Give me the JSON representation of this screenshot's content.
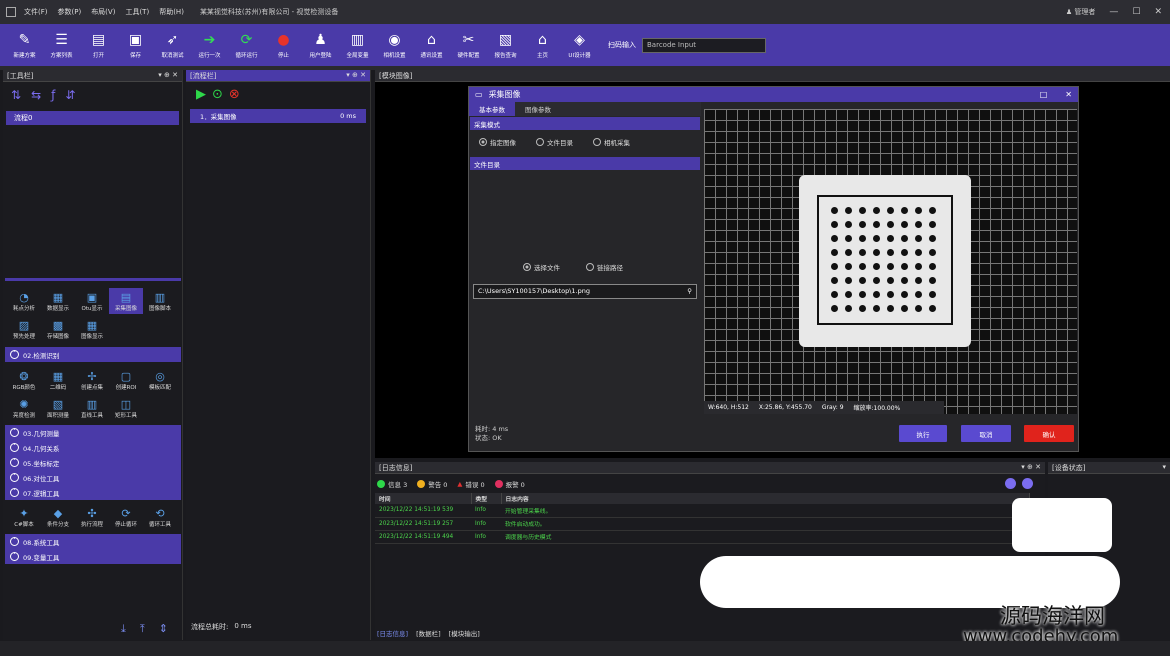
{
  "titlebar": {
    "menu": [
      "文件(F)",
      "参数(P)",
      "布局(V)",
      "工具(T)",
      "帮助(H)"
    ],
    "title": "某某视觉科技(苏州)有限公司 - 视觉检测设备",
    "user": "管理者",
    "min": "—",
    "max": "☐",
    "close": "✕"
  },
  "toolbar": {
    "buttons": [
      {
        "label": "新建方案",
        "icon": "✎",
        "color": "#ffffff"
      },
      {
        "label": "方案列表",
        "icon": "☰",
        "color": "#ffffff"
      },
      {
        "label": "打开",
        "icon": "▤",
        "color": "#ffffff"
      },
      {
        "label": "保存",
        "icon": "▣",
        "color": "#ffffff"
      },
      {
        "label": "取消测试",
        "icon": "➶",
        "color": "#ffffff"
      },
      {
        "label": "运行一次",
        "icon": "➔",
        "color": "#33dd55"
      },
      {
        "label": "循环运行",
        "icon": "⟳",
        "color": "#33dd55"
      },
      {
        "label": "停止",
        "icon": "●",
        "color": "#e8332a"
      },
      {
        "label": "用户登陆",
        "icon": "♟",
        "color": "#ffffff"
      },
      {
        "label": "全局变量",
        "icon": "▥",
        "color": "#ffffff"
      },
      {
        "label": "相机设置",
        "icon": "◉",
        "color": "#ffffff"
      },
      {
        "label": "通讯设置",
        "icon": "⌂",
        "color": "#ffffff"
      },
      {
        "label": "硬件配置",
        "icon": "✂",
        "color": "#ffffff"
      },
      {
        "label": "报告查询",
        "icon": "▧",
        "color": "#ffffff"
      },
      {
        "label": "主页",
        "icon": "⌂",
        "color": "#ffffff"
      },
      {
        "label": "UI设计器",
        "icon": "◈",
        "color": "#ffffff"
      }
    ],
    "scan_label": "扫码输入",
    "barcode_placeholder": "Barcode Input"
  },
  "toolpanel": {
    "title": "[工具栏]",
    "pin": "▾ ⊕ ✕",
    "flow_name": "流程0",
    "group1": [
      {
        "label": "耗点分析",
        "icon": "◔"
      },
      {
        "label": "数据显示",
        "icon": "▦"
      },
      {
        "label": "Otu显示",
        "icon": "▣"
      },
      {
        "label": "采集图像",
        "icon": "▤"
      },
      {
        "label": "图像脚本",
        "icon": "▥"
      },
      {
        "label": "预先处理",
        "icon": "▨"
      },
      {
        "label": "存储图像",
        "icon": "▩"
      },
      {
        "label": "图像显示",
        "icon": "▦"
      }
    ],
    "cat02": "02.检测识别",
    "group2": [
      {
        "label": "RGB颜色",
        "icon": "❂"
      },
      {
        "label": "二维码",
        "icon": "▦"
      },
      {
        "label": "创建点集",
        "icon": "✢"
      },
      {
        "label": "创建ROI",
        "icon": "▢"
      },
      {
        "label": "模板匹配",
        "icon": "◎"
      },
      {
        "label": "亮度检测",
        "icon": "✺"
      },
      {
        "label": "面积测量",
        "icon": "▧"
      },
      {
        "label": "直线工具",
        "icon": "▥"
      },
      {
        "label": "矩形工具",
        "icon": "◫"
      }
    ],
    "cats_a": [
      "03.几何测量",
      "04.几何关系",
      "05.坐标标定",
      "06.对位工具",
      "07.逻辑工具"
    ],
    "group3": [
      {
        "label": "C#脚本",
        "icon": "✦"
      },
      {
        "label": "条件分支",
        "icon": "◆"
      },
      {
        "label": "执行流程",
        "icon": "✣"
      },
      {
        "label": "停止循环",
        "icon": "⟳"
      },
      {
        "label": "循环工具",
        "icon": "⟲"
      }
    ],
    "cats_b": [
      "08.系统工具",
      "09.变量工具"
    ]
  },
  "flowpanel": {
    "title": "[流程栏]",
    "pin": "▾ ⊕ ✕",
    "item_name": "1．采集图像",
    "item_time": "0 ms",
    "total_label": "流程总耗时:",
    "total_value": "0 ms"
  },
  "imgpanel": {
    "title": "[模块图像]"
  },
  "dialog": {
    "title": "采集图像",
    "tabs": [
      "基本参数",
      "图像参数"
    ],
    "sec_mode": "采集模式",
    "modes": [
      "指定图像",
      "文件目录",
      "相机采集"
    ],
    "sec_dir": "文件目录",
    "file_opts": [
      "选择文件",
      "链接路径"
    ],
    "path": "C:\\Users\\SY100157\\Desktop\\1.png",
    "status_bar": [
      "W:640, H:512",
      "X:25.86, Y:455.70",
      "Gray: 9",
      "缩放率:100.00%"
    ],
    "time": "耗时: 4 ms",
    "state": "状态: OK",
    "btn_exec": "执行",
    "btn_cancel": "取消",
    "btn_ok": "确认"
  },
  "logpanel": {
    "title": "[日志信息]",
    "info": "信息 3",
    "warn": "警告 0",
    "error": "错误 0",
    "alarm": "报警 0",
    "headers": [
      "时间",
      "类型",
      "日志内容"
    ],
    "rows": [
      [
        "2023/12/22 14:51:19 539",
        "Info",
        "开始管理采集线。"
      ],
      [
        "2023/12/22 14:51:19 257",
        "Info",
        "软件启动成功。"
      ],
      [
        "2023/12/22 14:51:19 494",
        "Info",
        "调度器与历史模式"
      ]
    ],
    "tabs": [
      "[日志信息]",
      "[数据栏]",
      "[模块输出]"
    ]
  },
  "devpanel": {
    "title": "[设备状态]"
  },
  "watermark": {
    "line1": "源码海洋网",
    "line2": "www.codehy.com"
  }
}
